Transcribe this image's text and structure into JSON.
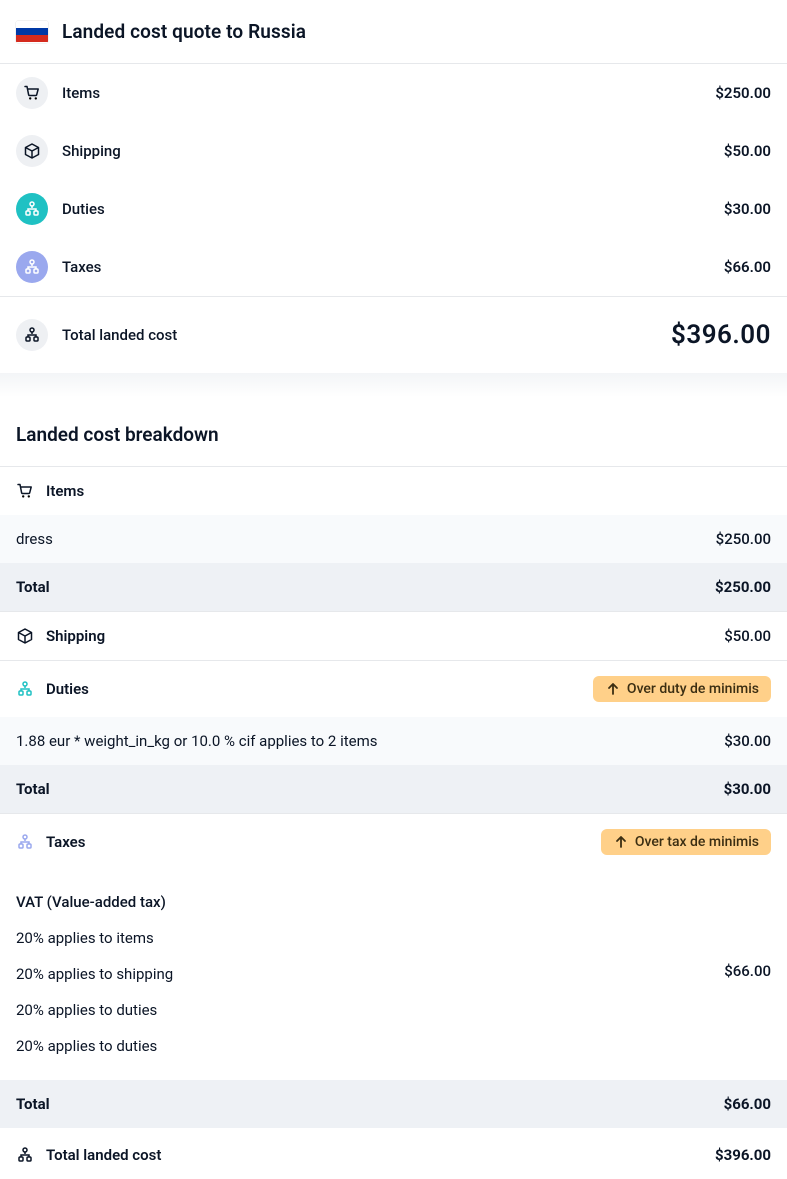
{
  "header": {
    "title": "Landed cost quote to Russia"
  },
  "summary": {
    "items": {
      "label": "Items",
      "amount": "$250.00"
    },
    "shipping": {
      "label": "Shipping",
      "amount": "$50.00"
    },
    "duties": {
      "label": "Duties",
      "amount": "$30.00"
    },
    "taxes": {
      "label": "Taxes",
      "amount": "$66.00"
    },
    "total": {
      "label": "Total landed cost",
      "amount": "$396.00"
    }
  },
  "breakdown": {
    "title": "Landed cost breakdown",
    "items": {
      "header": "Items",
      "lines": [
        {
          "name": "dress",
          "amount": "$250.00"
        }
      ],
      "total_label": "Total",
      "total_amount": "$250.00"
    },
    "shipping": {
      "header": "Shipping",
      "amount": "$50.00"
    },
    "duties": {
      "header": "Duties",
      "badge": "Over duty de minimis",
      "line": "1.88 eur * weight_in_kg or 10.0 % cif applies to 2 items",
      "line_amount": "$30.00",
      "total_label": "Total",
      "total_amount": "$30.00"
    },
    "taxes": {
      "header": "Taxes",
      "badge": "Over tax de minimis",
      "heading": "VAT (Value-added tax)",
      "lines": [
        "20% applies to items",
        "20% applies to shipping",
        "20% applies to duties",
        "20% applies to duties"
      ],
      "amount": "$66.00",
      "total_label": "Total",
      "total_amount": "$66.00"
    },
    "grand_total": {
      "label": "Total landed cost",
      "amount": "$396.00"
    }
  }
}
